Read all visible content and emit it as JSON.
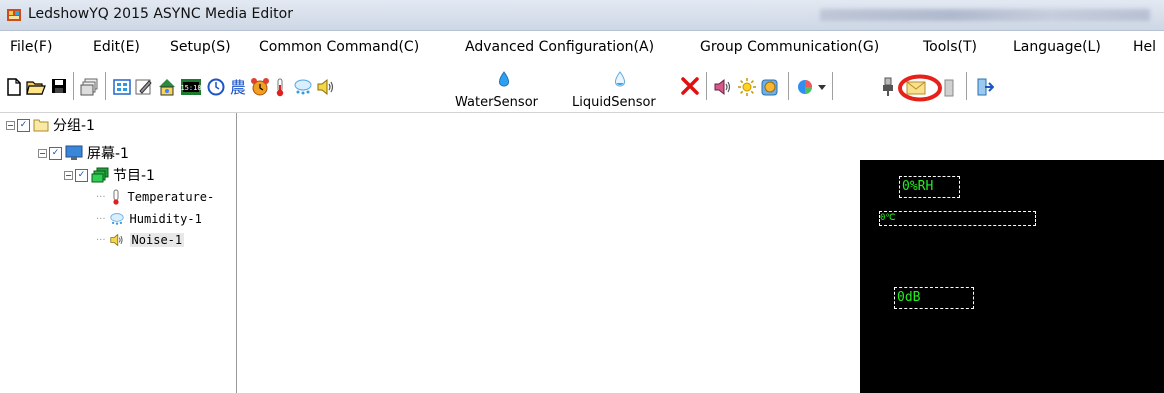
{
  "window": {
    "title": "LedshowYQ 2015 ASYNC Media Editor"
  },
  "menu": {
    "items": [
      "File(F)",
      "Edit(E)",
      "Setup(S)",
      "Common Command(C)",
      "Advanced Configuration(A)",
      "Group Communication(G)",
      "Tools(T)",
      "Language(L)",
      "Hel"
    ]
  },
  "toolbar": {
    "water_sensor_label": "WaterSensor",
    "liquid_sensor_label": "LiquidSensor"
  },
  "tree": {
    "group": "分组-1",
    "screen": "屏幕-1",
    "program": "节目-1",
    "items": [
      "Temperature-",
      "Humidity-1",
      "Noise-1"
    ]
  },
  "led": {
    "humidity": "0%RH",
    "temperature": "0℃",
    "noise": "0dB"
  },
  "colors": {
    "led_text": "#22ee22",
    "highlight_circle": "#e8201a",
    "delete": "#e01010"
  }
}
